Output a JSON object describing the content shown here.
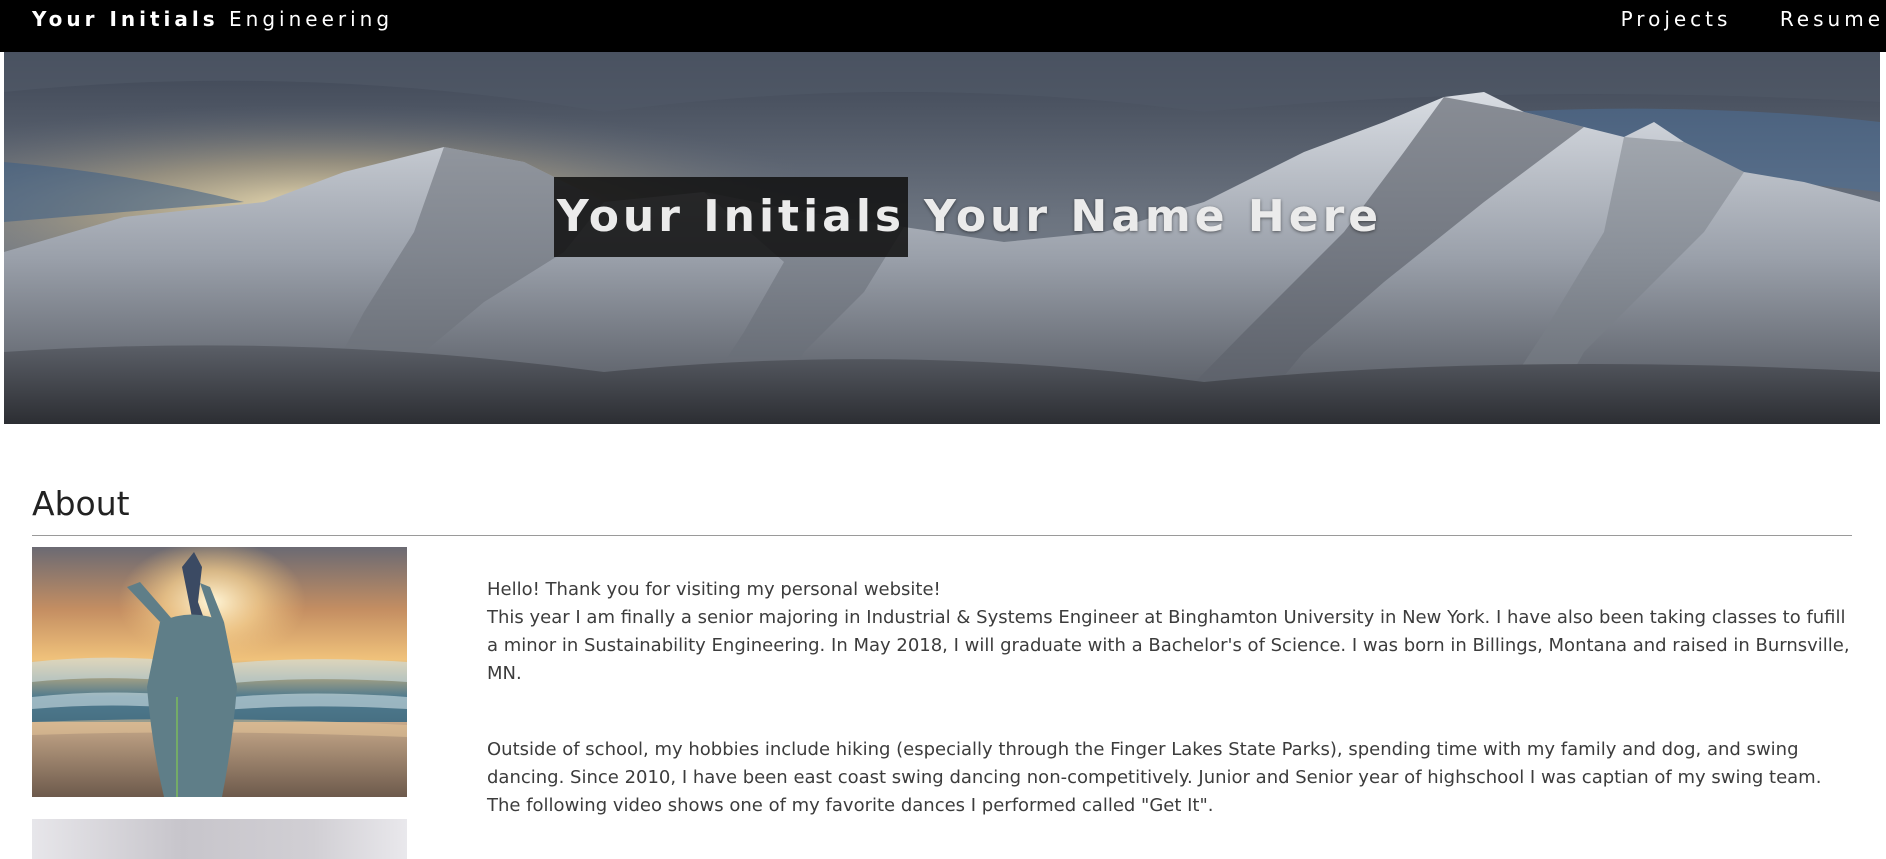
{
  "nav": {
    "brand_initials": "Your Initials",
    "brand_suffix": "Engineering",
    "links": [
      "Projects",
      "Resume"
    ]
  },
  "hero": {
    "initials": "Your Initials",
    "name": "Your Name Here"
  },
  "about": {
    "heading": "About",
    "paragraph1_line1": "Hello! Thank you for visiting my personal website!",
    "paragraph1_rest": "This year I am finally a senior majoring in Industrial & Systems Engineer at Binghamton University in New York. I have also been taking classes to fufill a minor in Sustainability Engineering. In May 2018, I will graduate with a Bachelor's of Science. I was born in Billings, Montana and raised in Burnsville, MN.",
    "paragraph2": "Outside of school, my hobbies include hiking (especially through the Finger Lakes State Parks), spending time with my family and dog, and swing dancing. Since 2010, I have been east coast swing dancing non-competitively. Junior and Senior year of highschool I was captian of my swing team. The following video shows one of my favorite dances I performed called \"Get It\"."
  },
  "colors": {
    "navbar_bg": "#000000",
    "nav_text": "#ffffff",
    "heading_text": "#222222",
    "body_text": "#3c3c3c",
    "rule": "#9a9a9a"
  },
  "icons": {
    "hero_image": "snowy-mountain-range-photo",
    "about_image": "woman-yoga-beach-sunset-photo"
  }
}
